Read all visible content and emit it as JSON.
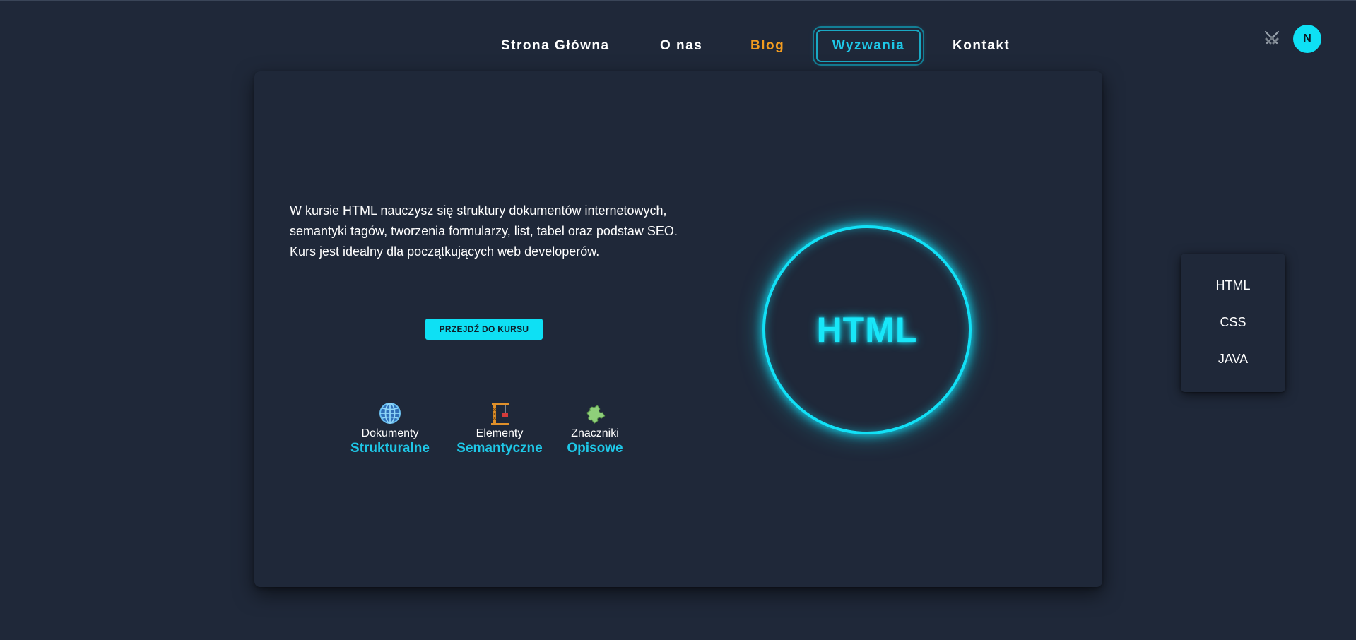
{
  "nav": {
    "items": [
      {
        "label": "Strona Główna"
      },
      {
        "label": "O nas"
      },
      {
        "label": "Blog"
      },
      {
        "label": "Wyzwania"
      },
      {
        "label": "Kontakt"
      }
    ],
    "active_index": 3
  },
  "header": {
    "icon": "crossed-swords-icon",
    "avatar_initial": "N"
  },
  "course": {
    "description": "W kursie HTML nauczysz się struktury dokumentów internetowych, semantyki tagów, tworzenia formularzy, list, tabel oraz podstaw SEO. Kurs jest idealny dla początkujących web developerów.",
    "cta_label": "PRZEJDŹ DO KURSU",
    "badge_label": "HTML",
    "features": [
      {
        "icon": "globe-icon",
        "sub": "Dokumenty",
        "main": "Strukturalne"
      },
      {
        "icon": "crane-icon",
        "sub": "Elementy",
        "main": "Semantyczne"
      },
      {
        "icon": "puzzle-icon",
        "sub": "Znaczniki",
        "main": "Opisowe"
      }
    ]
  },
  "side_menu": {
    "items": [
      {
        "label": "HTML"
      },
      {
        "label": "CSS"
      },
      {
        "label": "JAVA"
      }
    ]
  },
  "colors": {
    "background": "#1f2839",
    "accent": "#0ee0f4",
    "blog": "#f39c1f"
  }
}
